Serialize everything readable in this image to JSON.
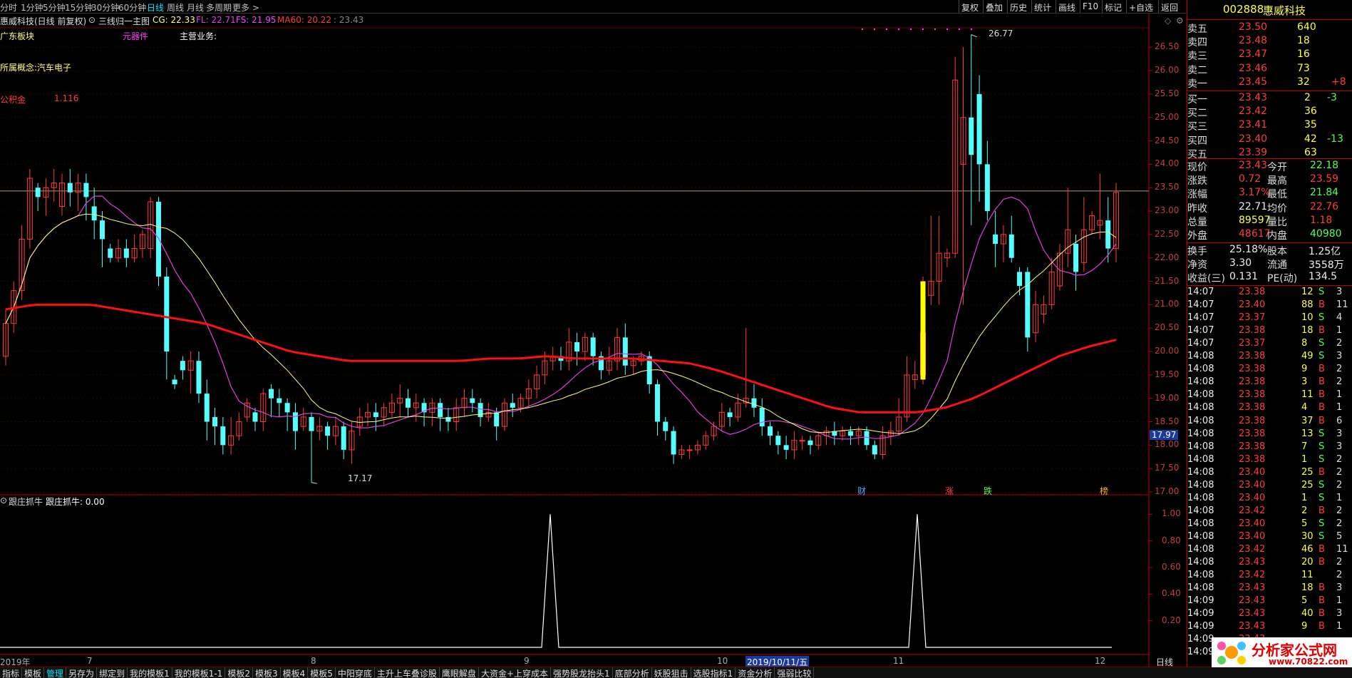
{
  "periods": [
    "分时",
    "1分钟",
    "5分钟",
    "15分钟",
    "30分钟",
    "60分钟",
    "日线",
    "周线",
    "月线",
    "多周期",
    "更多 >"
  ],
  "active_period": "日线",
  "toolbar": [
    "复权",
    "叠加",
    "历史",
    "统计",
    "画线",
    "F10",
    "标记",
    "+自选",
    "返回"
  ],
  "title": {
    "name": "惠威科技(日线 前复权)",
    "indicator": "三线归一主图",
    "cg_label": "CG: 22.33",
    "fl_label": "FL: 22.71",
    "fs_label": "FS: 21.95",
    "ma60_label": "MA60: 20.22",
    "extra": ": 23.43"
  },
  "overlay": {
    "sector": "广东板块",
    "component": "元器件",
    "business": "主营业务:",
    "concept": "所属概念:汽车电子",
    "gongjijin_label": "公积金",
    "gongjijin_value": "1.116",
    "high_label": "26.77",
    "low_label": "17.17",
    "price_tag": "17.97"
  },
  "events": [
    "财",
    "涨",
    "跌",
    "榜"
  ],
  "price_ticks": [
    "26.50",
    "26.00",
    "25.50",
    "25.00",
    "24.50",
    "24.00",
    "23.50",
    "23.00",
    "22.50",
    "22.00",
    "21.50",
    "21.00",
    "20.50",
    "20.00",
    "19.50",
    "19.00",
    "18.50",
    "18.00",
    "17.50",
    "17.00"
  ],
  "ind_ticks": [
    "1.00",
    "0.80",
    "0.60",
    "0.40",
    "0.20"
  ],
  "indicator": {
    "name": "跟庄抓牛",
    "label": "跟庄抓牛: 0.00"
  },
  "dates": {
    "year": "2019年",
    "m7": "7",
    "m8": "8",
    "m9": "9",
    "m10": "10",
    "selected": "2019/10/11/五",
    "m11": "11",
    "m12": "12"
  },
  "stock": {
    "code": "002888",
    "name": "惠威科技"
  },
  "asks": [
    {
      "label": "卖五",
      "price": "23.50",
      "vol": "640",
      "chg": ""
    },
    {
      "label": "卖四",
      "price": "23.48",
      "vol": "18",
      "chg": ""
    },
    {
      "label": "卖三",
      "price": "23.47",
      "vol": "16",
      "chg": ""
    },
    {
      "label": "卖二",
      "price": "23.46",
      "vol": "73",
      "chg": ""
    },
    {
      "label": "卖一",
      "price": "23.45",
      "vol": "32",
      "chg": "+8"
    }
  ],
  "bids": [
    {
      "label": "买一",
      "price": "23.43",
      "vol": "2",
      "chg": "-3"
    },
    {
      "label": "买二",
      "price": "23.42",
      "vol": "36",
      "chg": ""
    },
    {
      "label": "买三",
      "price": "23.41",
      "vol": "35",
      "chg": ""
    },
    {
      "label": "买四",
      "price": "23.40",
      "vol": "42",
      "chg": "-13"
    },
    {
      "label": "买五",
      "price": "23.39",
      "vol": "63",
      "chg": ""
    }
  ],
  "stats": [
    {
      "l1": "现价",
      "v1": "23.43",
      "c1": "red",
      "l2": "今开",
      "v2": "22.18",
      "c2": "green"
    },
    {
      "l1": "涨跌",
      "v1": "0.72",
      "c1": "red",
      "l2": "最高",
      "v2": "23.59",
      "c2": "red"
    },
    {
      "l1": "涨幅",
      "v1": "3.17%",
      "c1": "red",
      "l2": "最低",
      "v2": "21.84",
      "c2": "green"
    },
    {
      "l1": "昨收",
      "v1": "22.71",
      "c1": "white",
      "l2": "均价",
      "v2": "22.76",
      "c2": "red"
    },
    {
      "l1": "总量",
      "v1": "89597",
      "c1": "yellow",
      "l2": "量比",
      "v2": "1.18",
      "c2": "red"
    },
    {
      "l1": "外盘",
      "v1": "48617",
      "c1": "red",
      "l2": "内盘",
      "v2": "40980",
      "c2": "green"
    }
  ],
  "stats2": [
    {
      "l1": "换手",
      "v1": "25.18%",
      "l2": "股本",
      "v2": "1.25亿"
    },
    {
      "l1": "净资",
      "v1": "3.30",
      "l2": "流通",
      "v2": "3558万"
    },
    {
      "l1": "收益(三)",
      "v1": "0.131",
      "l2": "PE(动)",
      "v2": "134.5"
    }
  ],
  "ticks": [
    {
      "t": "14:07",
      "p": "23.38",
      "c": "red",
      "v": "12",
      "s": "S",
      "n": "3"
    },
    {
      "t": "14:07",
      "p": "23.40",
      "c": "red",
      "v": "88",
      "s": "B",
      "n": "11"
    },
    {
      "t": "14:07",
      "p": "23.37",
      "c": "red",
      "v": "10",
      "s": "S",
      "n": "4"
    },
    {
      "t": "14:07",
      "p": "23.38",
      "c": "red",
      "v": "18",
      "s": "B",
      "n": "1"
    },
    {
      "t": "14:07",
      "p": "23.37",
      "c": "red",
      "v": "8",
      "s": "S",
      "n": "2"
    },
    {
      "t": "14:08",
      "p": "23.38",
      "c": "red",
      "v": "49",
      "s": "S",
      "n": "3"
    },
    {
      "t": "14:08",
      "p": "23.38",
      "c": "red",
      "v": "9",
      "s": "B",
      "n": "2"
    },
    {
      "t": "14:08",
      "p": "23.38",
      "c": "red",
      "v": "3",
      "s": "B",
      "n": "2"
    },
    {
      "t": "14:08",
      "p": "23.38",
      "c": "red",
      "v": "11",
      "s": "B",
      "n": "1"
    },
    {
      "t": "14:08",
      "p": "23.38",
      "c": "red",
      "v": "4",
      "s": "B",
      "n": "1"
    },
    {
      "t": "14:08",
      "p": "23.38",
      "c": "red",
      "v": "37",
      "s": "B",
      "n": "6"
    },
    {
      "t": "14:08",
      "p": "23.38",
      "c": "red",
      "v": "13",
      "s": "S",
      "n": "3"
    },
    {
      "t": "14:08",
      "p": "23.38",
      "c": "red",
      "v": "7",
      "s": "S",
      "n": "3"
    },
    {
      "t": "14:08",
      "p": "23.38",
      "c": "red",
      "v": "1",
      "s": "S",
      "n": "2"
    },
    {
      "t": "14:08",
      "p": "23.40",
      "c": "red",
      "v": "25",
      "s": "B",
      "n": "2"
    },
    {
      "t": "14:08",
      "p": "23.40",
      "c": "red",
      "v": "25",
      "s": "S",
      "n": "2"
    },
    {
      "t": "14:08",
      "p": "23.40",
      "c": "red",
      "v": "1",
      "s": "S",
      "n": "1"
    },
    {
      "t": "14:08",
      "p": "23.42",
      "c": "red",
      "v": "2",
      "s": "B",
      "n": "2"
    },
    {
      "t": "14:08",
      "p": "23.40",
      "c": "red",
      "v": "5",
      "s": "S",
      "n": "2"
    },
    {
      "t": "14:08",
      "p": "23.40",
      "c": "red",
      "v": "30",
      "s": "S",
      "n": "5"
    },
    {
      "t": "14:08",
      "p": "23.42",
      "c": "red",
      "v": "46",
      "s": "B",
      "n": "11"
    },
    {
      "t": "14:08",
      "p": "23.43",
      "c": "red",
      "v": "20",
      "s": "B",
      "n": "2"
    },
    {
      "t": "14:08",
      "p": "23.42",
      "c": "red",
      "v": "11",
      "s": "",
      "n": "2"
    },
    {
      "t": "14:08",
      "p": "23.43",
      "c": "red",
      "v": "18",
      "s": "B",
      "n": "3"
    },
    {
      "t": "14:09",
      "p": "23.43",
      "c": "red",
      "v": "5",
      "s": "B",
      "n": "1"
    },
    {
      "t": "14:09",
      "p": "23.43",
      "c": "red",
      "v": "40",
      "s": "B",
      "n": "3"
    },
    {
      "t": "14:09",
      "p": "23.43",
      "c": "red",
      "v": "9",
      "s": "B",
      "n": "1"
    },
    {
      "t": "14:09",
      "p": "23.43",
      "c": "red",
      "v": "",
      "s": "",
      "n": ""
    },
    {
      "t": "14:09",
      "p": "",
      "c": "red",
      "v": "",
      "s": "",
      "n": ""
    }
  ],
  "bottom_tabs": [
    "指标",
    "模板",
    "管理",
    "另存为",
    "绑定到",
    "我的模板1",
    "我的模板1-1",
    "模板2",
    "模板3",
    "模板4",
    "模板5",
    "中阳穿底",
    "主升上车叠诊股",
    "鹰眼解盘",
    "大资金+上穿成本",
    "强势股龙抬头1",
    "底部分析",
    "妖股狙击",
    "选股指标1",
    "资金分析",
    "强弱比较"
  ],
  "active_tab": "管理",
  "bottom_right_period": "日线",
  "watermark": {
    "text": "分析家公式网",
    "url": "www.70822.com"
  },
  "colors": {
    "up": "#ff3c3c",
    "down": "#54ffff",
    "ma60": "#ff1010",
    "cg": "#ffff80",
    "fl": "#e040e0",
    "fs": "#ff40ff",
    "accent": "#00e5ff",
    "signal": "#ffff00"
  },
  "chart_data": {
    "type": "candlestick",
    "ylim": [
      17.0,
      26.9
    ],
    "price_series": [
      {
        "name": "CG",
        "values": []
      },
      {
        "name": "FL",
        "values": []
      },
      {
        "name": "FS",
        "values": []
      },
      {
        "name": "MA60",
        "values": []
      }
    ],
    "candles": [
      [
        19.9,
        20.6,
        19.7,
        20.9
      ],
      [
        20.6,
        21.3,
        20.4,
        21.5
      ],
      [
        21.3,
        22.4,
        21.1,
        22.7
      ],
      [
        22.4,
        23.7,
        22.2,
        23.9
      ],
      [
        23.5,
        23.3,
        23.0,
        23.6
      ],
      [
        23.3,
        23.5,
        22.9,
        23.7
      ],
      [
        23.5,
        23.6,
        23.2,
        23.9
      ],
      [
        23.1,
        23.6,
        22.9,
        23.8
      ],
      [
        23.6,
        23.4,
        23.1,
        23.9
      ],
      [
        23.4,
        23.6,
        23.0,
        23.8
      ],
      [
        23.6,
        23.3,
        22.8,
        23.8
      ],
      [
        23.1,
        22.8,
        22.4,
        23.5
      ],
      [
        22.8,
        22.4,
        21.8,
        23.0
      ],
      [
        22.2,
        22.0,
        21.9,
        22.3
      ],
      [
        22.0,
        22.2,
        21.9,
        22.4
      ],
      [
        22.2,
        22.0,
        21.8,
        22.4
      ],
      [
        22.0,
        22.2,
        21.9,
        22.5
      ],
      [
        22.2,
        22.5,
        22.0,
        22.6
      ],
      [
        22.2,
        23.2,
        22.0,
        23.3
      ],
      [
        23.2,
        21.6,
        21.4,
        23.3
      ],
      [
        21.6,
        20.0,
        19.4,
        21.8
      ],
      [
        19.4,
        19.3,
        19.2,
        19.5
      ],
      [
        19.8,
        19.6,
        19.4,
        19.9
      ],
      [
        19.6,
        19.8,
        19.1,
        20.0
      ],
      [
        19.8,
        19.1,
        18.9,
        20.0
      ],
      [
        19.1,
        18.5,
        18.1,
        19.4
      ],
      [
        18.6,
        18.4,
        18.0,
        18.8
      ],
      [
        18.4,
        18.0,
        17.8,
        18.6
      ],
      [
        18.0,
        18.2,
        17.8,
        18.6
      ],
      [
        18.2,
        18.5,
        18.1,
        18.7
      ],
      [
        18.6,
        18.9,
        18.5,
        19.0
      ],
      [
        18.7,
        18.5,
        18.3,
        18.8
      ],
      [
        18.5,
        19.1,
        18.3,
        19.2
      ],
      [
        19.2,
        19.0,
        18.6,
        19.3
      ],
      [
        19.0,
        18.9,
        18.6,
        19.2
      ],
      [
        18.9,
        18.7,
        18.3,
        19.0
      ],
      [
        18.7,
        18.3,
        17.9,
        18.9
      ],
      [
        18.4,
        18.6,
        18.3,
        18.8
      ],
      [
        18.6,
        18.3,
        17.2,
        18.7
      ],
      [
        18.3,
        18.4,
        18.1,
        18.6
      ],
      [
        18.4,
        18.2,
        17.9,
        18.5
      ],
      [
        18.2,
        18.4,
        18.0,
        18.6
      ],
      [
        18.4,
        17.9,
        17.7,
        18.5
      ],
      [
        17.9,
        18.3,
        17.6,
        18.5
      ],
      [
        18.4,
        18.6,
        18.2,
        18.8
      ],
      [
        18.6,
        18.7,
        18.4,
        18.9
      ],
      [
        18.7,
        18.6,
        18.3,
        18.9
      ],
      [
        18.6,
        18.8,
        18.4,
        18.9
      ],
      [
        18.7,
        18.9,
        18.6,
        19.1
      ],
      [
        18.9,
        19.0,
        18.6,
        19.3
      ],
      [
        19.0,
        18.8,
        18.6,
        19.2
      ],
      [
        18.8,
        18.9,
        18.5,
        19.1
      ],
      [
        18.9,
        18.7,
        18.4,
        19.0
      ],
      [
        18.7,
        18.9,
        18.4,
        19.0
      ],
      [
        18.9,
        18.6,
        18.3,
        19.0
      ],
      [
        18.6,
        18.5,
        18.3,
        18.8
      ],
      [
        18.5,
        18.8,
        18.3,
        19.0
      ],
      [
        18.8,
        19.0,
        18.6,
        19.2
      ],
      [
        19.0,
        18.9,
        18.7,
        19.2
      ],
      [
        18.9,
        18.6,
        18.4,
        19.0
      ],
      [
        18.6,
        18.7,
        18.5,
        18.9
      ],
      [
        18.7,
        18.4,
        18.1,
        18.8
      ],
      [
        18.4,
        18.9,
        18.3,
        19.0
      ],
      [
        18.9,
        18.8,
        18.6,
        19.1
      ],
      [
        18.8,
        19.0,
        18.7,
        19.1
      ],
      [
        19.0,
        19.2,
        18.8,
        19.4
      ],
      [
        19.2,
        19.5,
        19.0,
        19.7
      ],
      [
        19.5,
        19.8,
        19.3,
        20.0
      ],
      [
        19.8,
        19.9,
        19.6,
        20.1
      ],
      [
        19.9,
        19.8,
        19.6,
        20.1
      ],
      [
        19.8,
        20.2,
        19.6,
        20.5
      ],
      [
        20.2,
        20.0,
        19.7,
        20.4
      ],
      [
        20.0,
        20.3,
        19.8,
        20.4
      ],
      [
        20.3,
        19.9,
        19.7,
        20.4
      ],
      [
        19.9,
        19.6,
        19.4,
        20.0
      ],
      [
        19.6,
        19.8,
        19.5,
        20.1
      ],
      [
        19.8,
        20.3,
        19.6,
        20.5
      ],
      [
        20.3,
        19.7,
        19.5,
        20.6
      ],
      [
        19.7,
        19.8,
        19.5,
        19.9
      ],
      [
        19.8,
        19.9,
        19.7,
        20.0
      ],
      [
        19.9,
        19.3,
        19.1,
        20.0
      ],
      [
        19.3,
        18.5,
        18.2,
        19.4
      ],
      [
        18.5,
        18.3,
        18.1,
        18.6
      ],
      [
        18.3,
        17.8,
        17.6,
        18.4
      ],
      [
        17.8,
        17.9,
        17.7,
        18.0
      ],
      [
        17.9,
        17.9,
        17.7,
        18.0
      ],
      [
        17.9,
        18.0,
        17.8,
        18.1
      ],
      [
        18.0,
        18.2,
        17.9,
        18.3
      ],
      [
        18.2,
        18.4,
        18.1,
        18.5
      ],
      [
        18.4,
        18.7,
        18.3,
        18.9
      ],
      [
        18.7,
        18.6,
        18.4,
        18.8
      ],
      [
        18.6,
        18.9,
        18.5,
        19.1
      ],
      [
        18.9,
        19.0,
        18.8,
        20.5
      ],
      [
        19.0,
        18.8,
        18.6,
        19.3
      ],
      [
        18.8,
        18.4,
        18.2,
        19.0
      ],
      [
        18.4,
        18.2,
        18.0,
        18.5
      ],
      [
        18.2,
        18.0,
        17.8,
        18.3
      ],
      [
        18.0,
        17.9,
        17.7,
        18.2
      ],
      [
        17.9,
        18.1,
        17.7,
        18.3
      ],
      [
        18.1,
        18.1,
        17.9,
        18.2
      ],
      [
        18.1,
        18.0,
        17.8,
        18.2
      ],
      [
        18.0,
        18.2,
        17.9,
        18.3
      ],
      [
        18.2,
        18.3,
        18.0,
        18.4
      ],
      [
        18.3,
        18.2,
        18.0,
        18.5
      ],
      [
        18.2,
        18.3,
        18.1,
        18.4
      ],
      [
        18.3,
        18.2,
        18.0,
        18.4
      ],
      [
        18.2,
        18.3,
        18.0,
        18.4
      ],
      [
        18.3,
        18.0,
        17.9,
        18.4
      ],
      [
        18.0,
        17.8,
        17.7,
        18.1
      ],
      [
        17.8,
        18.2,
        17.7,
        18.4
      ],
      [
        18.2,
        18.3,
        18.0,
        18.5
      ],
      [
        18.3,
        18.6,
        18.2,
        19.0
      ],
      [
        18.6,
        19.5,
        18.5,
        19.9
      ],
      [
        19.4,
        19.5,
        19.2,
        19.8
      ],
      [
        19.5,
        20.4,
        19.3,
        21.6
      ],
      [
        21.2,
        21.5,
        21.0,
        22.9
      ],
      [
        21.5,
        22.1,
        21.0,
        22.9
      ],
      [
        22.0,
        22.1,
        21.8,
        22.2
      ],
      [
        22.1,
        25.8,
        22.0,
        26.3
      ],
      [
        24.0,
        25.0,
        21.0,
        26.5
      ],
      [
        25.0,
        24.2,
        22.7,
        26.77
      ],
      [
        25.5,
        24.0,
        23.2,
        25.9
      ],
      [
        24.0,
        23.0,
        22.8,
        24.5
      ],
      [
        22.5,
        22.3,
        21.8,
        23.0
      ],
      [
        22.3,
        22.5,
        21.9,
        22.7
      ],
      [
        22.5,
        22.0,
        21.9,
        22.9
      ],
      [
        21.7,
        21.4,
        21.2,
        21.8
      ],
      [
        21.7,
        20.3,
        20.0,
        21.8
      ],
      [
        20.4,
        21.0,
        20.2,
        21.3
      ],
      [
        20.8,
        21.0,
        20.6,
        21.2
      ],
      [
        21.0,
        21.7,
        20.9,
        22.0
      ],
      [
        21.4,
        22.1,
        21.3,
        22.3
      ],
      [
        22.1,
        22.6,
        21.8,
        23.5
      ],
      [
        22.3,
        21.7,
        21.3,
        22.5
      ],
      [
        21.9,
        22.6,
        21.7,
        23.3
      ],
      [
        22.6,
        22.9,
        22.5,
        23.0
      ],
      [
        22.7,
        22.8,
        22.4,
        23.8
      ],
      [
        22.8,
        22.2,
        21.9,
        23.3
      ],
      [
        22.2,
        23.4,
        21.9,
        23.6
      ]
    ],
    "indicator_series": {
      "name": "跟庄抓牛",
      "peaks": [
        {
          "bar": "9月中",
          "value": 1.0
        },
        {
          "bar": "11月初",
          "value": 1.0
        }
      ],
      "ylim": [
        0,
        1.05
      ]
    }
  }
}
